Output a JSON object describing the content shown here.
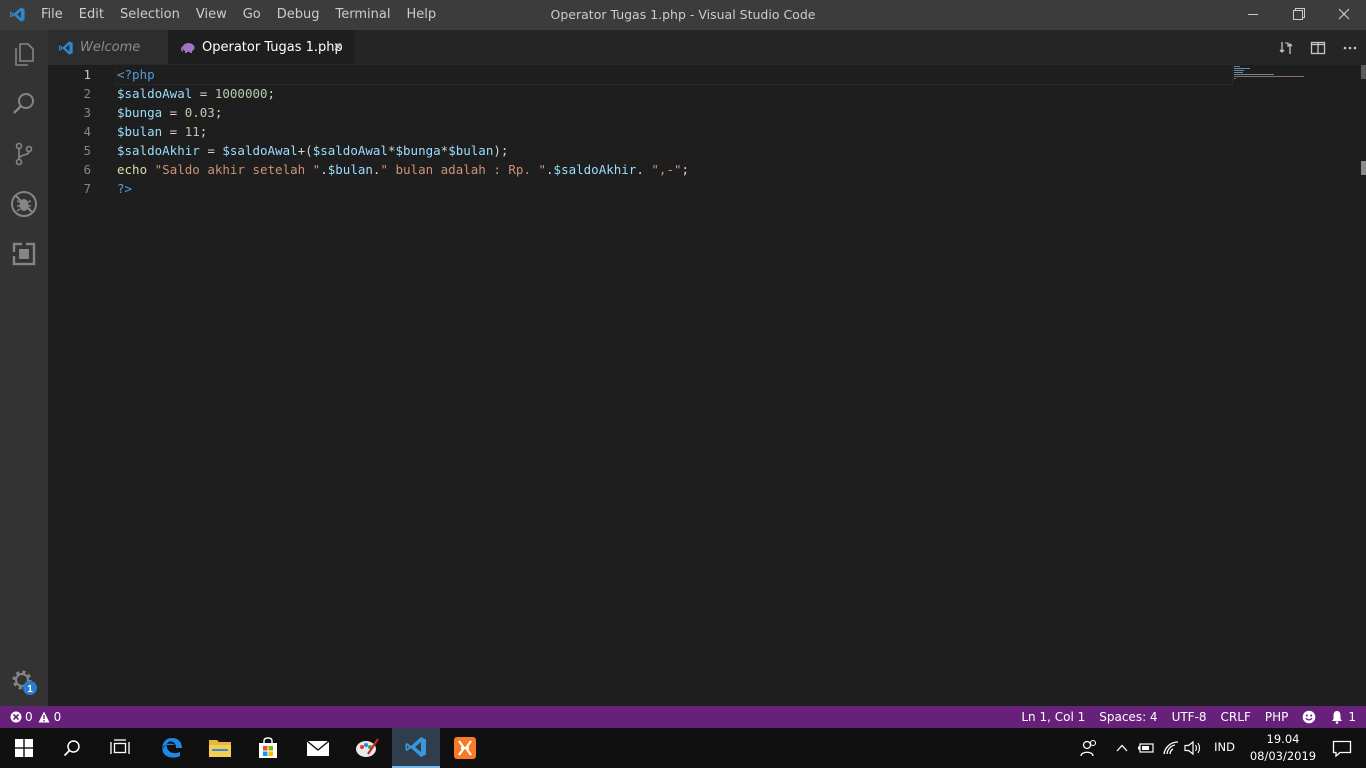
{
  "titlebar": {
    "menu": [
      "File",
      "Edit",
      "Selection",
      "View",
      "Go",
      "Debug",
      "Terminal",
      "Help"
    ],
    "window_title": "Operator Tugas 1.php - Visual Studio Code"
  },
  "tabs": [
    {
      "label": "Welcome",
      "active": false
    },
    {
      "label": "Operator Tugas 1.php",
      "active": true
    }
  ],
  "editor": {
    "line_numbers": [
      "1",
      "2",
      "3",
      "4",
      "5",
      "6",
      "7"
    ],
    "lines": [
      "<?php",
      "$saldoAwal = 1000000;",
      "$bunga = 0.03;",
      "$bulan = 11;",
      "$saldoAkhir = $saldoAwal+($saldoAwal*$bunga*$bulan);",
      "echo \"Saldo akhir setelah \".$bulan.\" bulan adalah : Rp. \".$saldoAkhir. \",-\";",
      "?>"
    ]
  },
  "activitybar": {
    "items": [
      "explorer-icon",
      "search-icon",
      "source-control-icon",
      "debug-icon",
      "extensions-icon"
    ],
    "settings_badge": "1"
  },
  "statusbar": {
    "errors": "0",
    "warnings": "0",
    "position": "Ln 1, Col 1",
    "spaces": "Spaces: 4",
    "encoding": "UTF-8",
    "eol": "CRLF",
    "language": "PHP",
    "notifications": "1"
  },
  "taskbar": {
    "language": "IND",
    "time": "19.04",
    "date": "08/03/2019"
  },
  "colors": {
    "accent": "#68217a",
    "titlebar": "#3c3c3c",
    "editor_bg": "#1e1e1e"
  }
}
